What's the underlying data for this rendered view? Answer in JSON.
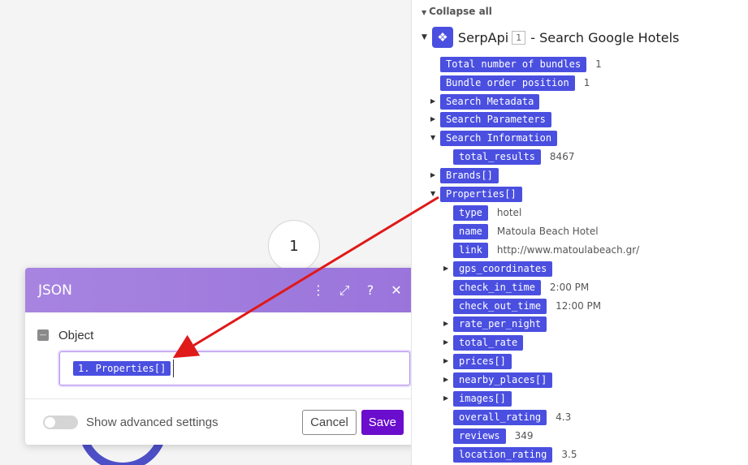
{
  "canvas": {
    "bubble_label": "1"
  },
  "dialog": {
    "title": "JSON",
    "object_label": "Object",
    "field_chip": "1. Properties[]",
    "advanced_label": "Show advanced settings",
    "cancel_label": "Cancel",
    "save_label": "Save"
  },
  "panel": {
    "collapse_all": "Collapse all",
    "app_name": "SerpApi",
    "app_badge": "1",
    "app_operation": "- Search Google Hotels",
    "items": [
      {
        "label": "Total number of bundles",
        "value": "1"
      },
      {
        "label": "Bundle order position",
        "value": "1"
      },
      {
        "label": "Search Metadata",
        "value": ""
      },
      {
        "label": "Search Parameters",
        "value": ""
      },
      {
        "label": "Search Information",
        "value": ""
      },
      {
        "label": "total_results",
        "value": "8467"
      },
      {
        "label": "Brands[]",
        "value": ""
      },
      {
        "label": "Properties[]",
        "value": ""
      },
      {
        "label": "type",
        "value": "hotel"
      },
      {
        "label": "name",
        "value": "Matoula Beach Hotel"
      },
      {
        "label": "link",
        "value": "http://www.matoulabeach.gr/"
      },
      {
        "label": "gps_coordinates",
        "value": ""
      },
      {
        "label": "check_in_time",
        "value": "2:00 PM"
      },
      {
        "label": "check_out_time",
        "value": "12:00 PM"
      },
      {
        "label": "rate_per_night",
        "value": ""
      },
      {
        "label": "total_rate",
        "value": ""
      },
      {
        "label": "prices[]",
        "value": ""
      },
      {
        "label": "nearby_places[]",
        "value": ""
      },
      {
        "label": "images[]",
        "value": ""
      },
      {
        "label": "overall_rating",
        "value": "4.3"
      },
      {
        "label": "reviews",
        "value": "349"
      },
      {
        "label": "location_rating",
        "value": "3.5"
      }
    ]
  },
  "colors": {
    "tag": "#4a4fe0",
    "header_gradient_start": "#a784e0",
    "save_button": "#6a0dcc",
    "arrow": "#e01919"
  }
}
